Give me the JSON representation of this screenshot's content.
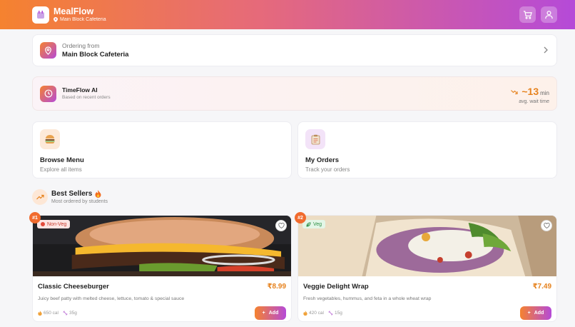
{
  "header": {
    "app_name": "MealFlow",
    "location": "Main Block Cafeteria",
    "cart_icon": "cart-icon",
    "profile_icon": "user-icon",
    "gradient": [
      "#f5822f",
      "#e66a7a",
      "#b54ad8"
    ]
  },
  "ordering": {
    "label": "Ordering from",
    "value": "Main Block Cafeteria"
  },
  "timeflow": {
    "title": "TimeFlow AI",
    "subtitle": "Based on recent orders",
    "wait_prefix": "~",
    "wait_value": "13",
    "wait_unit": "min",
    "wait_caption": "avg. wait time"
  },
  "tiles": [
    {
      "title": "Browse Menu",
      "subtitle": "Explore all items",
      "icon": "burger-icon"
    },
    {
      "title": "My Orders",
      "subtitle": "Track your orders",
      "icon": "clipboard-icon"
    }
  ],
  "best_sellers": {
    "title": "Best Sellers",
    "subtitle": "Most ordered by students"
  },
  "products": [
    {
      "rank": "#1",
      "tag": "Non-Veg",
      "name": "Classic Cheeseburger",
      "price": "₹8.99",
      "description": "Juicy beef patty with melted cheese, lettuce, tomato & special sauce",
      "calories": "650 cal",
      "protein": "35g",
      "add_label": "Add"
    },
    {
      "rank": "#2",
      "tag": "Veg",
      "name": "Veggie Delight Wrap",
      "price": "₹7.49",
      "description": "Fresh vegetables, hummus, and feta in a whole wheat wrap",
      "calories": "420 cal",
      "protein": "15g",
      "add_label": "Add"
    }
  ]
}
